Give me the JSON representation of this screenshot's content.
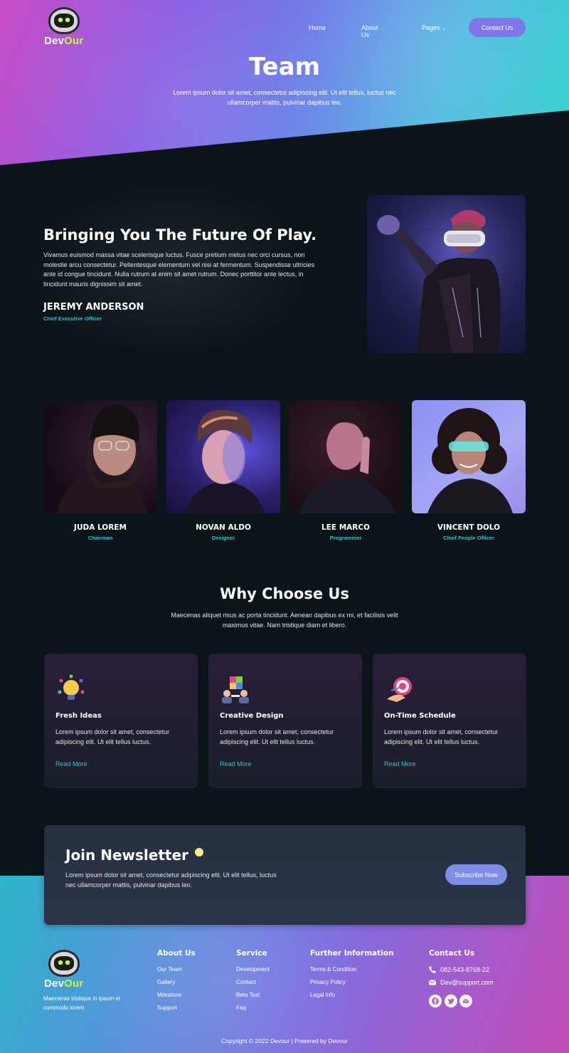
{
  "brand": {
    "name_part1": "Dev",
    "name_part2": "Our",
    "accent": "#c8f43c"
  },
  "nav": {
    "home": "Home",
    "about": "About Us",
    "pages": "Pages",
    "contact": "Contact Us"
  },
  "hero": {
    "title": "Team",
    "subtitle": "Lorem ipsum dolor sit amet, consectetur adipiscing elit. Ut elit tellus, luctus nec ullamcorper mattis, pulvinar dapibus leo."
  },
  "ceo": {
    "title": "Bringing You The Future Of Play.",
    "text": "Vivamus euismod massa vitae scelerisque luctus. Fusce pretium metus nec orci cursus, non molestie arcu consectetur. Pellentesque elementum vel nisi at fermentum. Suspendisse ultricies ante id congue tincidunt. Nulla rutrum at enim sit amet rutrum. Donec porttitor ante lectus, in tincidunt mauris dignissim sit amet.",
    "name": "JEREMY ANDERSON",
    "role": "Chief Executive Officer"
  },
  "team": [
    {
      "name": "JUDA LOREM",
      "role": "Chairman"
    },
    {
      "name": "NOVAN ALDO",
      "role": "Designer"
    },
    {
      "name": "LEE MARCO",
      "role": "Programmer"
    },
    {
      "name": "VINCENT DOLO",
      "role": "Chief People Officer"
    }
  ],
  "why": {
    "title": "Why Choose Us",
    "subtitle": "Maecenas aliquet risus ac porta tincidunt. Aenean dapibus ex mi, et facilisis velit maximus vitae. Nam tristique diam et libero.",
    "cards": [
      {
        "title": "Fresh Ideas",
        "text": "Lorem ipsum dolor sit amet, consectetur adipiscing elit. Ut elit tellus luctus.",
        "link": "Read More",
        "icon": "lightbulb-icon"
      },
      {
        "title": "Creative Design",
        "text": "Lorem ipsum dolor sit amet, consectetur adipiscing elit. Ut elit tellus luctus.",
        "link": "Read More",
        "icon": "puzzle-team-icon"
      },
      {
        "title": "On-Time Schedule",
        "text": "Lorem ipsum dolor sit amet, consectetur adipiscing elit. Ut elit tellus luctus.",
        "link": "Read More",
        "icon": "target-hand-icon"
      }
    ]
  },
  "newsletter": {
    "title": "Join Newsletter",
    "text": "Lorem ipsum dolor sit amet, consectetur adipiscing elit. Ut elit tellus, luctus nec ullamcorper mattis, pulvinar dapibus leo.",
    "button": "Subscribe Now"
  },
  "footer": {
    "description": "Maecenas tristique in ipsum et commodo lorem",
    "about": {
      "title": "About Us",
      "links": [
        "Our Team",
        "Gallery",
        "Milestone",
        "Support"
      ]
    },
    "service": {
      "title": "Service",
      "links": [
        "Development",
        "Contact",
        "Beta Test",
        "Faq"
      ]
    },
    "further": {
      "title": "Further Information",
      "links": [
        "Terms & Condition",
        "Privacy Policy",
        "Legal Info"
      ]
    },
    "contact": {
      "title": "Contact Us",
      "phone": "082-543-8768-22",
      "email": "Dev@support.com"
    },
    "social": [
      "facebook-icon",
      "twitter-icon",
      "email-icon"
    ],
    "copyright": "Copyright © 2022 Devour | Powered by Devour"
  }
}
